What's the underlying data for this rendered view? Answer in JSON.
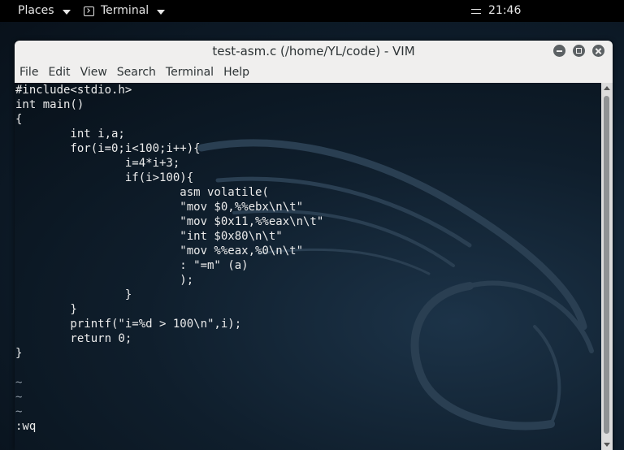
{
  "topbar": {
    "places_label": "Places",
    "app_label": "Terminal",
    "clock": "21:46"
  },
  "window": {
    "title": "test-asm.c (/home/YL/code) - VIM"
  },
  "menu": {
    "items": [
      "File",
      "Edit",
      "View",
      "Search",
      "Terminal",
      "Help"
    ]
  },
  "editor": {
    "lines": [
      "#include<stdio.h>",
      "int main()",
      "{",
      "        int i,a;",
      "        for(i=0;i<100;i++){",
      "                i=4*i+3;",
      "                if(i>100){",
      "                        asm volatile(",
      "                        \"mov $0,%%ebx\\n\\t\"",
      "                        \"mov $0x11,%%eax\\n\\t\"",
      "                        \"int $0x80\\n\\t\"",
      "                        \"mov %%eax,%0\\n\\t\"",
      "                        : \"=m\" (a)",
      "                        );",
      "                }",
      "        }",
      "        printf(\"i=%d > 100\\n\",i);",
      "        return 0;",
      "}",
      ""
    ],
    "empty_lines": [
      "~",
      "~",
      "~"
    ],
    "command": ":wq"
  },
  "colors": {
    "terminal_text": "#ececec",
    "tilde": "#8b96a2",
    "titlebar_bg": "#f0efee",
    "panel_bg": "#000000"
  }
}
